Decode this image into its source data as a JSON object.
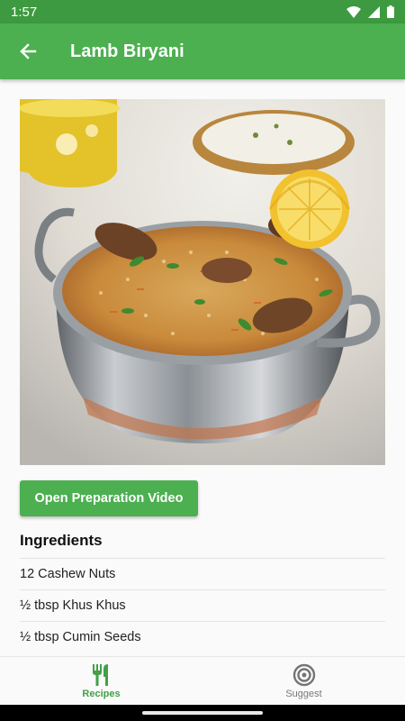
{
  "status_bar": {
    "time": "1:57"
  },
  "app_bar": {
    "title": "Lamb Biryani"
  },
  "main": {
    "video_button_label": "Open Preparation Video",
    "ingredients_heading": "Ingredients",
    "ingredients": [
      "12 Cashew Nuts",
      "½ tbsp Khus Khus",
      "½ tbsp Cumin Seeds"
    ]
  },
  "bottom_nav": {
    "items": [
      {
        "label": "Recipes",
        "icon": "fork-knife-icon",
        "active": true
      },
      {
        "label": "Suggest",
        "icon": "target-icon",
        "active": false
      }
    ]
  },
  "colors": {
    "primary": "#4caf50",
    "status_bar": "#3d9a40",
    "active_nav": "#43a047"
  }
}
